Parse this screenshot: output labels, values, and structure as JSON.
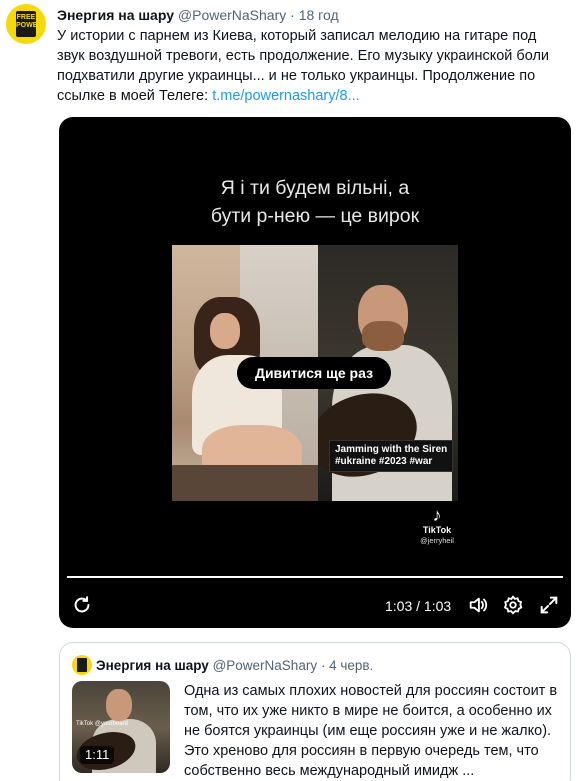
{
  "tweet": {
    "author_name": "Энергия на шару",
    "author_handle": "@PowerNaShary",
    "separator": "·",
    "time": "18 год",
    "avatar": {
      "badge_line1": "FREE",
      "badge_line2": "POWER"
    },
    "text": "У истории с парнем из Киева, который записал мелодию на гитаре под звук воздушной тревоги, есть продолжение. Его  музыку украинской боли подхватили другие украинцы... и не только украинцы. Продолжение по ссылке в моей Телеге: ",
    "link": "t.me/powernashary/8..."
  },
  "video": {
    "caption_line1": "Я і ти будем вільні, а",
    "caption_line2": "бути р-нею — це вирок",
    "replay_label": "Дивитися ще раз",
    "overlay_tag": {
      "line1": "Jamming with the Siren",
      "line2": "#ukraine #2023 #war"
    },
    "watermark": {
      "logo": "♪",
      "brand": "TikTok",
      "user": "@jerryheil"
    },
    "progress": 1.0,
    "timecode": "1:03 / 1:03",
    "icons": {
      "replay": "replay-icon",
      "volume": "volume-icon",
      "settings": "settings-icon",
      "fullscreen": "fullscreen-icon"
    }
  },
  "quoted_tweet": {
    "author_name": "Энергия на шару",
    "author_handle": "@PowerNaShary",
    "separator": "·",
    "time": "4 черв.",
    "thumbnail_duration": "1:11",
    "thumbnail_watermark": "TikTok\n@yourbeard",
    "text": "Одна из самых плохих новостей для россиян состоит в том, что их уже никто в мире не боится, а особенно их не боятся украинцы (им еще россиян уже и не жалко). Это хреново для россиян в первую очередь тем, что собственно весь международный имидж ..."
  },
  "colors": {
    "link": "#1d9bf0",
    "secondary_text": "#536471",
    "avatar_yellow": "#f5d90a",
    "border": "#cfd9de"
  }
}
